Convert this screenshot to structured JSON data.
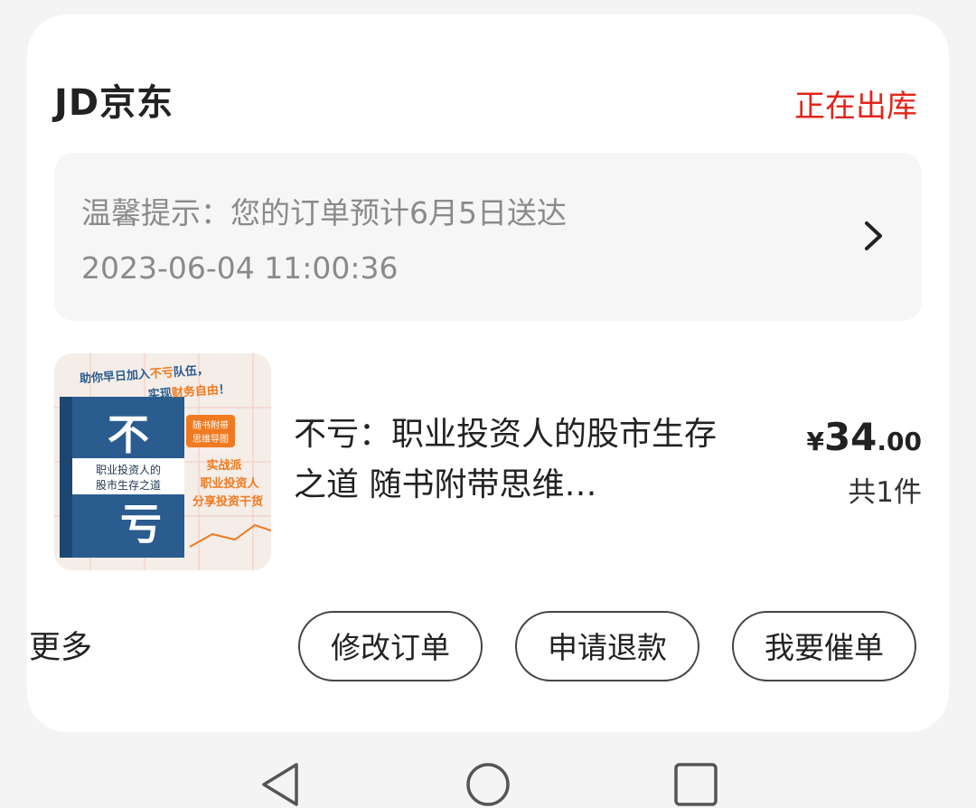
{
  "order": {
    "shop_name": "JD京东",
    "status": "正在出库",
    "tip_text": "温馨提示：您的订单预计6月5日送达",
    "tip_time": "2023-06-04 11:00:36",
    "tip_arrow_icon": "chevron-right-icon"
  },
  "product": {
    "title": "不亏：职业投资人的股市生存之道  随书附带思维…",
    "price_symbol": "¥",
    "price_integer": "34",
    "price_decimal": ".00",
    "quantity": "共1件",
    "cover": {
      "banner_line1_a": "助你早日加入",
      "banner_line1_b": "不亏",
      "banner_line1_c": "队伍，",
      "banner_line2_a": "实现",
      "banner_line2_b": "财务自由",
      "banner_line2_c": "！",
      "big_char_1": "不",
      "big_char_2": "亏",
      "subtitle_1": "职业投资人的",
      "subtitle_2": "股市生存之道",
      "badge_1": "随书附带",
      "badge_2": "思维导图",
      "slogan_1": "实战派",
      "slogan_2": "职业投资人",
      "slogan_3": "分享投资干货"
    }
  },
  "actions": {
    "more_label": "更多",
    "modify_label": "修改订单",
    "refund_label": "申请退款",
    "urge_label": "我要催单"
  },
  "navbar": {
    "back_icon": "back-triangle-icon",
    "home_icon": "home-circle-icon",
    "recents_icon": "recents-square-icon"
  },
  "colors": {
    "accent": "#e1251b",
    "cover_blue": "#2a5c8f",
    "cover_orange": "#f07a1f"
  }
}
